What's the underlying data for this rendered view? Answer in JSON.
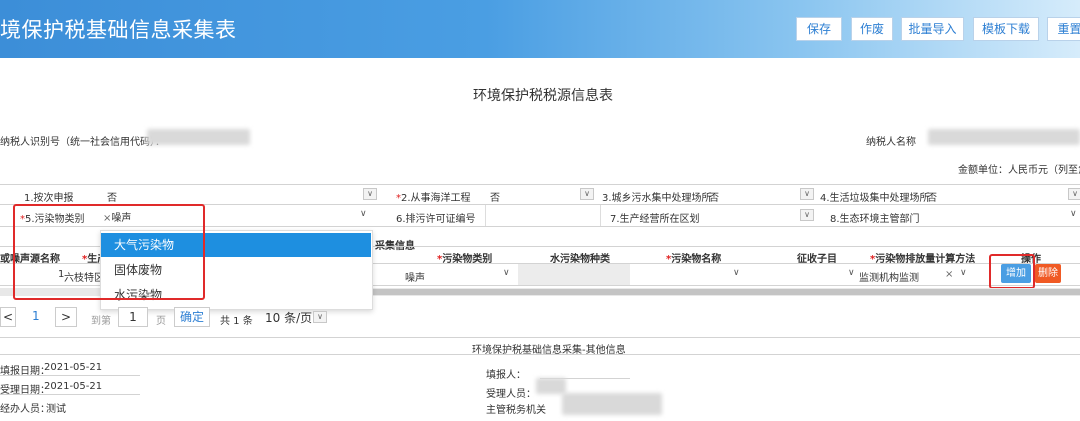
{
  "header": {
    "title": "境保护税基础信息采集表",
    "buttons": [
      "保存",
      "作废",
      "批量导入",
      "模板下载",
      "重置"
    ]
  },
  "form": {
    "title": "环境保护税税源信息表",
    "taxpayer_id_label": "纳税人识别号（统一社会信用代码）：",
    "taxpayer_name_label": "纳税人名称",
    "unit_label": "金额单位：人民币元（列至角分"
  },
  "fields": {
    "f1": {
      "label": "1.按次申报",
      "value": "否"
    },
    "f2": {
      "label": "*2.从事海洋工程",
      "value": "否"
    },
    "f3": {
      "label": "3.城乡污水集中处理场所",
      "value": "否"
    },
    "f4": {
      "label": "4.生活垃圾集中处理场所",
      "value": "否"
    },
    "f5": {
      "label": "*5.污染物类别",
      "value": "噪声"
    },
    "f6": {
      "label": "6.排污许可证编号",
      "value": ""
    },
    "f7": {
      "label": "7.生产经营所在区划",
      "value": ""
    },
    "f8": {
      "label": "8.生态环境主管部门",
      "value": ""
    }
  },
  "dropdown": {
    "options": [
      "大气污染物",
      "固体废物",
      "水污染物"
    ],
    "selected": "大气污染物"
  },
  "table": {
    "section_title": "采集信息",
    "left_headers": [
      "或噪声源名称",
      "*生产"
    ],
    "headers": [
      "*污染物类别",
      "水污染物种类",
      "*污染物名称",
      "征收子目",
      "*污染物排放量计算方法",
      "操作"
    ],
    "row": {
      "index": "1",
      "name": "六枝特区",
      "pollutant_type": "噪声",
      "method": "监测机构监测"
    },
    "add_label": "增加",
    "delete_label": "删除"
  },
  "pager": {
    "first": "<",
    "current": "1",
    "next": ">",
    "goto_label": "到第",
    "page_input": "1",
    "page_unit": "页",
    "confirm": "确定",
    "total": "共 1 条",
    "page_size": "10 条/页"
  },
  "other": {
    "title": "环境保护税基础信息采集-其他信息",
    "fill_date_label": "填报日期：",
    "fill_date": "2021-05-21",
    "accept_date_label": "受理日期：",
    "accept_date": "2021-05-21",
    "handler_label": "经办人员：",
    "handler": "测试",
    "filler_label": "填报人：",
    "acceptor_label": "受理人员：",
    "tax_office_label": "主管税务机关"
  }
}
